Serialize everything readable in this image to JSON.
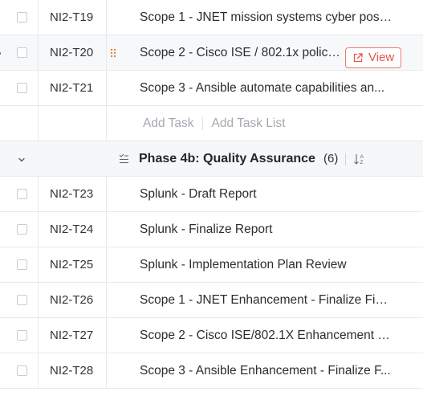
{
  "tasks_top": [
    {
      "id": "NI2-T19",
      "title": "Scope 1 - JNET mission systems cyber post..."
    },
    {
      "id": "NI2-T20",
      "title": "Scope 2 - Cisco ISE / 802.1x policies..."
    },
    {
      "id": "NI2-T21",
      "title": "Scope 3 - Ansible automate capabilities an..."
    }
  ],
  "view_button": {
    "label": "View",
    "icon": "open-external-icon"
  },
  "add_actions": {
    "add_task": "Add Task",
    "add_task_list": "Add Task List"
  },
  "phase": {
    "title": "Phase 4b: Quality Assurance",
    "count": "(6)"
  },
  "tasks_bottom": [
    {
      "id": "NI2-T23",
      "title": "Splunk - Draft Report"
    },
    {
      "id": "NI2-T24",
      "title": "Splunk - Finalize Report"
    },
    {
      "id": "NI2-T25",
      "title": "Splunk - Implementation Plan Review"
    },
    {
      "id": "NI2-T26",
      "title": "Scope 1 - JNET Enhancement - Finalize Fin..."
    },
    {
      "id": "NI2-T27",
      "title": "Scope 2 - Cisco ISE/802.1X Enhancement - ..."
    },
    {
      "id": "NI2-T28",
      "title": "Scope 3 - Ansible Enhancement - Finalize F..."
    }
  ],
  "colors": {
    "accent": "#e2574a",
    "border": "#e7e9ee",
    "muted": "#a4a8b0"
  }
}
